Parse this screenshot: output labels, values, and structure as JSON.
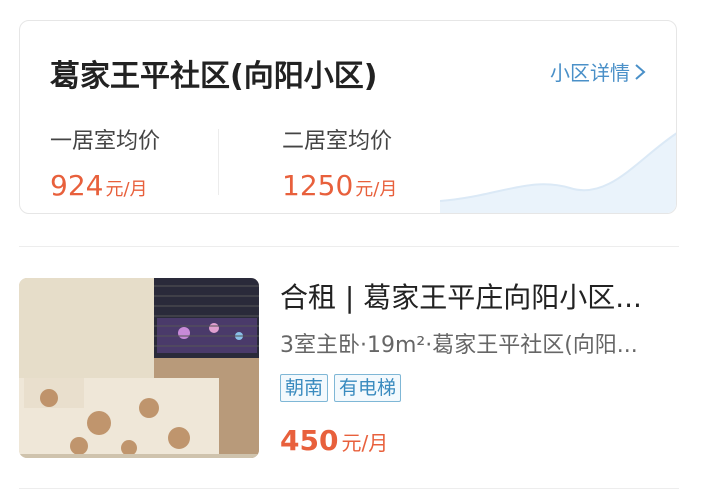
{
  "community": {
    "name": "葛家王平社区(向阳小区)",
    "details_link": "小区详情",
    "prices": [
      {
        "label": "一居室均价",
        "value": "924",
        "unit": "元/月"
      },
      {
        "label": "二居室均价",
        "value": "1250",
        "unit": "元/月"
      }
    ]
  },
  "listing": {
    "title": "合租 | 葛家王平庄向阳小区...",
    "subtitle": "3室主卧·19m²·葛家王平社区(向阳...",
    "tags": [
      "朝南",
      "有电梯"
    ],
    "price": "450",
    "price_unit": "元/月"
  },
  "colors": {
    "accent_price": "#e8603c",
    "link": "#4a90c8",
    "tag_border": "#7fb7d6"
  }
}
